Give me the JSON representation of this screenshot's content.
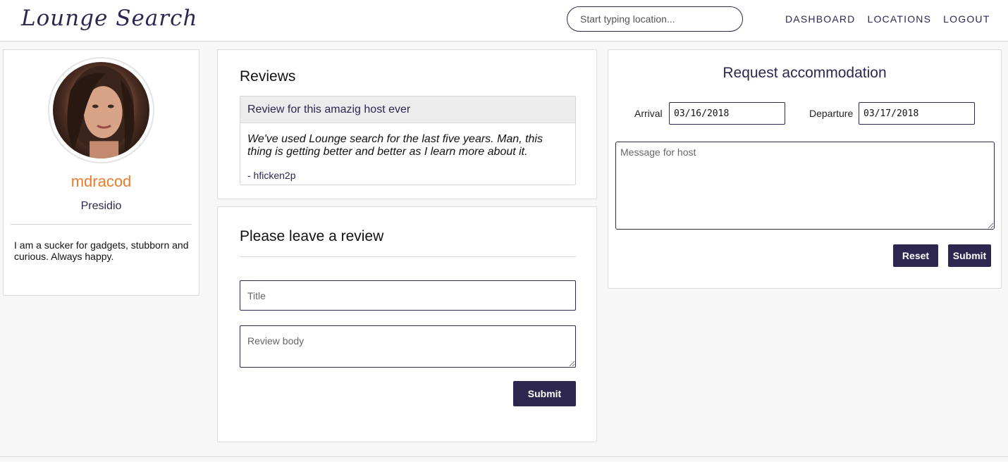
{
  "header": {
    "logo": "Lounge Search",
    "search_placeholder": "Start typing location...",
    "nav": [
      "DASHBOARD",
      "LOCATIONS",
      "LOGOUT"
    ]
  },
  "profile": {
    "username": "mdracod",
    "location": "Presidio",
    "bio": "I am a sucker for gadgets, stubborn and curious. Always happy."
  },
  "reviews": {
    "title": "Reviews",
    "items": [
      {
        "heading": "Review for this amazig host ever",
        "body": "We've used Lounge search for the last five years. Man, this thing is getting better and better as I learn more about it.",
        "author": "- hficken2p"
      }
    ]
  },
  "leave_review": {
    "title": "Please leave a review",
    "title_placeholder": "Title",
    "body_placeholder": "Review body",
    "submit_label": "Submit"
  },
  "request": {
    "title": "Request accommodation",
    "arrival_label": "Arrival",
    "arrival_value": "03/16/2018",
    "departure_label": "Departure",
    "departure_value": "03/17/2018",
    "message_placeholder": "Message for host",
    "reset_label": "Reset",
    "submit_label": "Submit"
  },
  "colors": {
    "brand": "#2d2750",
    "accent": "#ee7b2a",
    "background": "#f7f7f7"
  }
}
